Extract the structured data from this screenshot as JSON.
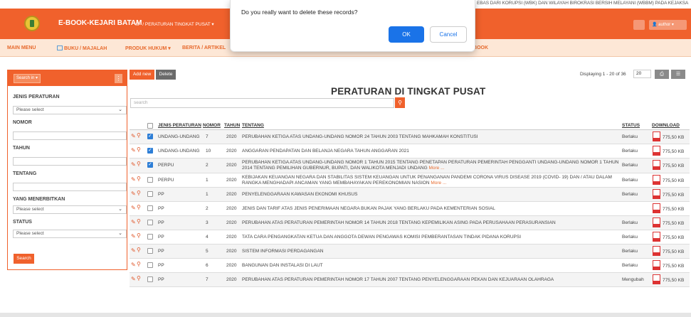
{
  "ticker": "EBAS DARI KORUPSI (WBK) DAN WILAYAH BIROKRASI BERSIH MELAYANI (WBBM) PADA KEJAKSA",
  "header": {
    "brand": "E-BOOK-KEJARI BATAM",
    "breadcrumb": "PERATURAN TINGKAT PUSAT ▾",
    "user": "author ▾"
  },
  "menu": {
    "main_menu": "MAIN MENU",
    "buku_majalah": "BUKU / MAJALAH",
    "produk_hukum": "PRODUK HUKUM ▾",
    "berita_artikel": "BERITA / ARTIKEL",
    "ebook": "G EBOOK"
  },
  "dialog": {
    "message": "Do you really want to delete these records?",
    "ok": "OK",
    "cancel": "Cancel"
  },
  "sidebar": {
    "search_in": "Search in ▾",
    "jenis_peraturan_label": "JENIS PERATURAN",
    "jenis_peraturan_value": "Please select",
    "nomor_label": "NOMOR",
    "tahun_label": "TAHUN",
    "tentang_label": "TENTANG",
    "menerbitkan_label": "YANG MENERBITKAN",
    "menerbitkan_value": "Please select",
    "status_label": "STATUS",
    "status_value": "Please select",
    "search_button": "Search"
  },
  "toolbar": {
    "add_new": "Add new",
    "delete": "Delete",
    "displaying": "Displaying 1 - 20 of 36",
    "per_page": "20"
  },
  "page_title": "PERATURAN DI TINGKAT PUSAT",
  "search_placeholder": "search",
  "table": {
    "headers": {
      "jenis": "JENIS PERATURAN",
      "nomor": "NOMOR",
      "tahun": "TAHUN",
      "tentang": "TENTANG",
      "status": "STATUS",
      "download": "DOWNLOAD"
    },
    "rows": [
      {
        "jenis": "UNDANG-UNDANG",
        "nomor": "7",
        "tahun": "2020",
        "tentang": "PERUBAHAN KETIGA ATAS UNDANG-UNDANG NOMOR 24 TAHUN 2003 TENTANG MAHKAMAH KONSTITUSI",
        "more": "",
        "status": "Berlaku",
        "size": "775,50 KB",
        "checked": true
      },
      {
        "jenis": "UNDANG-UNDANG",
        "nomor": "10",
        "tahun": "2020",
        "tentang": "ANGGARAN PENDAPATAN DAN BELANJA NEGARA TAHUN ANGGARAN 2021",
        "more": "",
        "status": "Berlaku",
        "size": "775,50 KB",
        "checked": true
      },
      {
        "jenis": "PERPU",
        "nomor": "2",
        "tahun": "2020",
        "tentang": "PERUBAHAN KETIGA ATAS UNDANG-UNDANG NOMOR 1 TAHUN 2015 TENTANG PENETAPAN PERATURAN PEMERINTAH PENGGANTI UNDANG-UNDANG NOMOR 1 TAHUN 2014 TENTANG PEMILIHAN GUBERNUR, BUPATI, DAN WALIKOTA MENJADI UNDANG",
        "more": "More ...",
        "status": "Berlaku",
        "size": "775,50 KB",
        "checked": true
      },
      {
        "jenis": "PERPU",
        "nomor": "1",
        "tahun": "2020",
        "tentang": "KEBIJAKAN KEUANGAN NEGARA DAN STABILITAS SISTEM KEUANGAN UNTUK PENANGANAN PANDEMI CORONA VIRUS DISEASE 2019 (COVID- 19) DAN / ATAU DALAM RANGKA MENGHADAPI ANCAMAN YANG MEMBAHAYAKAN PEREKONOMIAN NASION",
        "more": "More ...",
        "status": "Berlaku",
        "size": "775,50 KB",
        "checked": false
      },
      {
        "jenis": "PP",
        "nomor": "1",
        "tahun": "2020",
        "tentang": "PENYELENGGARAAN KAWASAN EKONOMI KHUSUS",
        "more": "",
        "status": "Berlaku",
        "size": "775,50 KB",
        "checked": false
      },
      {
        "jenis": "PP",
        "nomor": "2",
        "tahun": "2020",
        "tentang": "JENIS DAN TARIF ATAS JENIS PENERIMAAN NEGARA BUKAN PAJAK YANG BERLAKU PADA KEMENTERIAN SOSIAL",
        "more": "",
        "status": "",
        "size": "775,50 KB",
        "checked": false
      },
      {
        "jenis": "PP",
        "nomor": "3",
        "tahun": "2020",
        "tentang": "PERUBAHAN ATAS PERATURAN PEMERINTAH NOMOR 14 TAHUN 2018 TENTANG KEPEMILIKAN ASING PADA PERUSAHAAN PERASURANSIAN",
        "more": "",
        "status": "Berlaku",
        "size": "775,50 KB",
        "checked": false
      },
      {
        "jenis": "PP",
        "nomor": "4",
        "tahun": "2020",
        "tentang": "TATA CARA PENGANGKATAN KETUA DAN ANGGOTA DEWAN PENGAWAS KOMISI PEMBERANTASAN TINDAK PIDANA KORUPSI",
        "more": "",
        "status": "Berlaku",
        "size": "775,50 KB",
        "checked": false
      },
      {
        "jenis": "PP",
        "nomor": "5",
        "tahun": "2020",
        "tentang": "SISTEM INFORMASI PERDAGANGAN",
        "more": "",
        "status": "Berlaku",
        "size": "775,50 KB",
        "checked": false
      },
      {
        "jenis": "PP",
        "nomor": "6",
        "tahun": "2020",
        "tentang": "BANGUNAN DAN INSTALASI DI LAUT",
        "more": "",
        "status": "Berlaku",
        "size": "775,50 KB",
        "checked": false
      },
      {
        "jenis": "PP",
        "nomor": "7",
        "tahun": "2020",
        "tentang": "PERUBAHAN ATAS PERATURAN PEMERINTAH NOMOR 17 TAHUN 2007 TENTANG PENYELENGGARAAN PEKAN DAN KEJUARAAN OLAHRAGA",
        "more": "",
        "status": "Mengubah",
        "size": "775,50 KB",
        "checked": false
      }
    ]
  },
  "colors": {
    "brand": "#f0612c",
    "menu_bg": "#fde7d6",
    "dialog_ok": "#1a73e8"
  }
}
